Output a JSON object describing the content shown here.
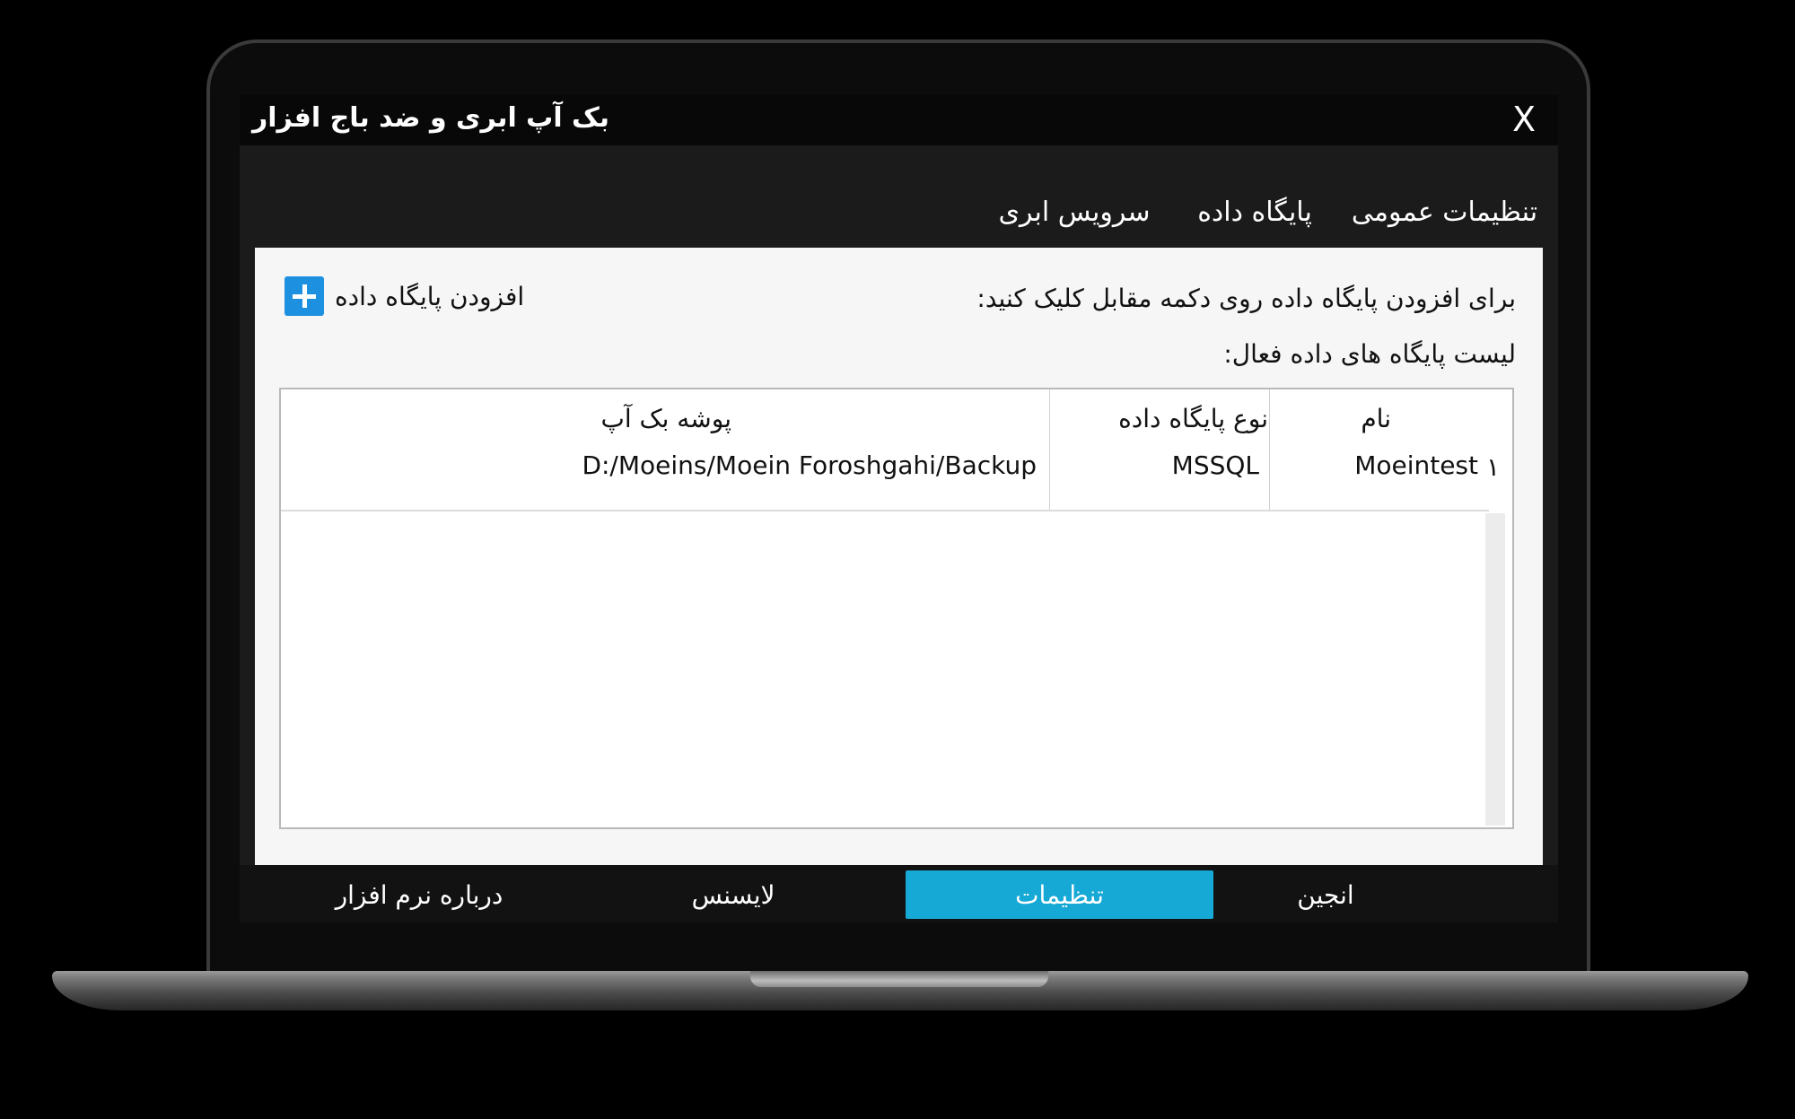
{
  "window": {
    "title": "بک آپ ابری و ضد باج افزار",
    "close_label": "X"
  },
  "tabs": [
    {
      "label": "تنظیمات عمومی",
      "active": false
    },
    {
      "label": "پایگاه داده",
      "active": true
    },
    {
      "label": "سرویس ابری",
      "active": false
    }
  ],
  "panel": {
    "instruction": "برای افزودن پایگاه داده روی دکمه مقابل کلیک کنید:",
    "add_button_label": "افزودن پایگاه داده",
    "list_title": "لیست پایگاه های داده فعال:"
  },
  "table": {
    "columns": [
      "نام",
      "نوع پایگاه داده",
      "پوشه بک آپ"
    ],
    "rows": [
      {
        "index": "۱",
        "name": "Moeintest",
        "type": "MSSQL",
        "folder": "D:/Moeins/Moein Foroshgahi/Backup"
      }
    ]
  },
  "bottom_nav": [
    {
      "label": "انجین",
      "active": false
    },
    {
      "label": "تنظیمات",
      "active": true
    },
    {
      "label": "لایسنس",
      "active": false
    },
    {
      "label": "درباره نرم افزار",
      "active": false
    }
  ],
  "colors": {
    "accent": "#17a9d6",
    "add_icon": "#1e90e0",
    "window_bg": "#1b1b1b",
    "panel_bg": "#f6f6f6"
  }
}
